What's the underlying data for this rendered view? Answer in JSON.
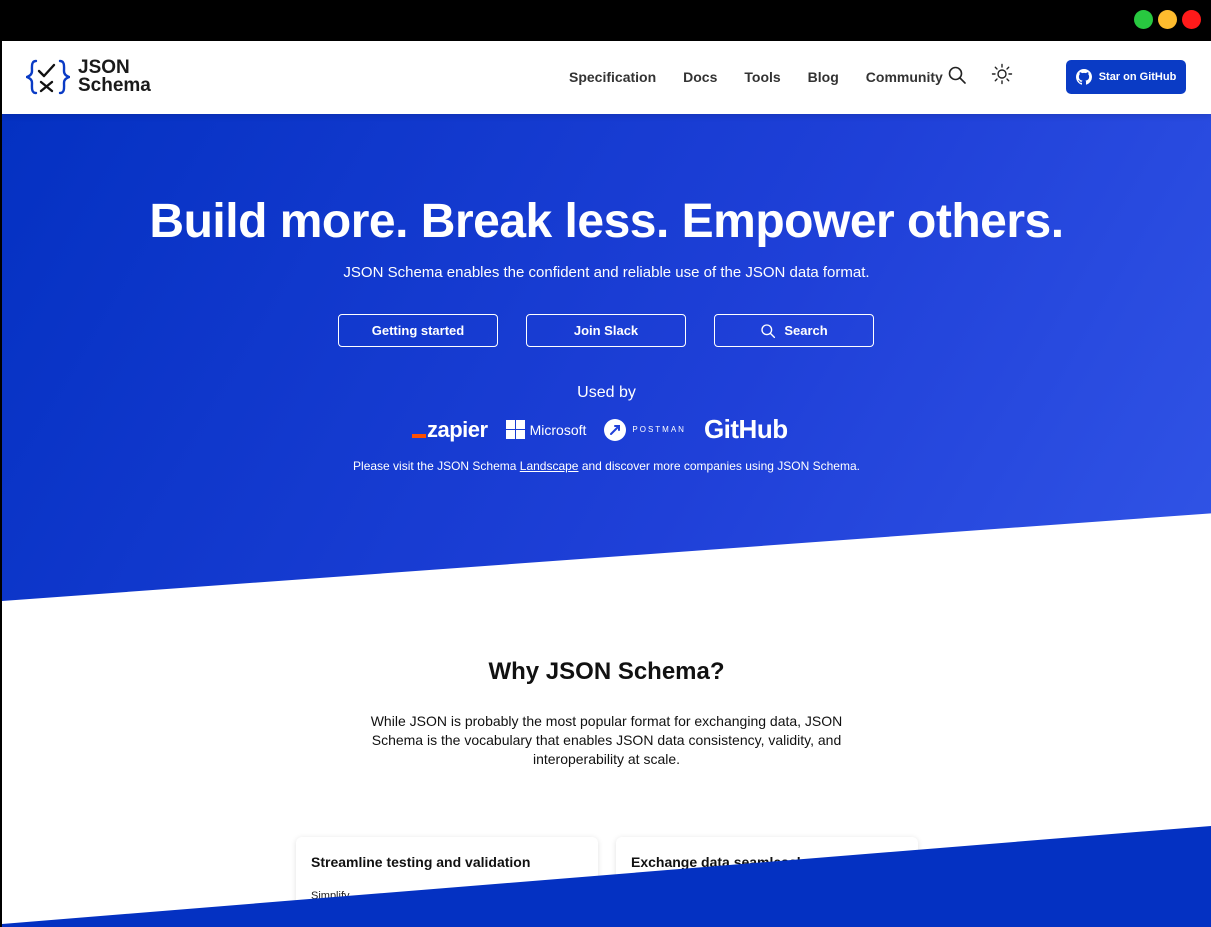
{
  "window": {
    "controls": [
      {
        "name": "maximize",
        "color": "#28c840"
      },
      {
        "name": "minimize",
        "color": "#febc2e"
      },
      {
        "name": "close",
        "color": "#ff1a1a"
      }
    ]
  },
  "header": {
    "logo_line1": "JSON",
    "logo_line2": "Schema",
    "nav": [
      "Specification",
      "Docs",
      "Tools",
      "Blog",
      "Community"
    ],
    "search_icon": "search-icon",
    "theme_icon": "sun-icon",
    "github_button": "Star on GitHub"
  },
  "hero": {
    "title": "Build more. Break less. Empower others.",
    "subtitle": "JSON Schema enables the confident and reliable use of the JSON data format.",
    "buttons": {
      "getting_started": "Getting started",
      "join_slack": "Join Slack",
      "search": "Search"
    },
    "used_by": "Used by",
    "companies": {
      "zapier": "zapier",
      "microsoft": "Microsoft",
      "postman": "POSTMAN",
      "github": "GitHub"
    },
    "visit_before": "Please visit the JSON Schema ",
    "visit_link": "Landscape",
    "visit_after": " and discover more companies using JSON Schema."
  },
  "why": {
    "title": "Why JSON Schema?",
    "text": "While JSON is probably the most popular format for exchanging data, JSON Schema is the vocabulary that enables JSON data consistency, validity, and interoperability at scale.",
    "cards": [
      {
        "title": "Streamline testing and validation",
        "body": "Simplify"
      },
      {
        "title": "Exchange data seamlessly",
        "body": ""
      }
    ]
  },
  "colors": {
    "brand_blue": "#0431c2",
    "button_blue": "#0a3bc5"
  }
}
